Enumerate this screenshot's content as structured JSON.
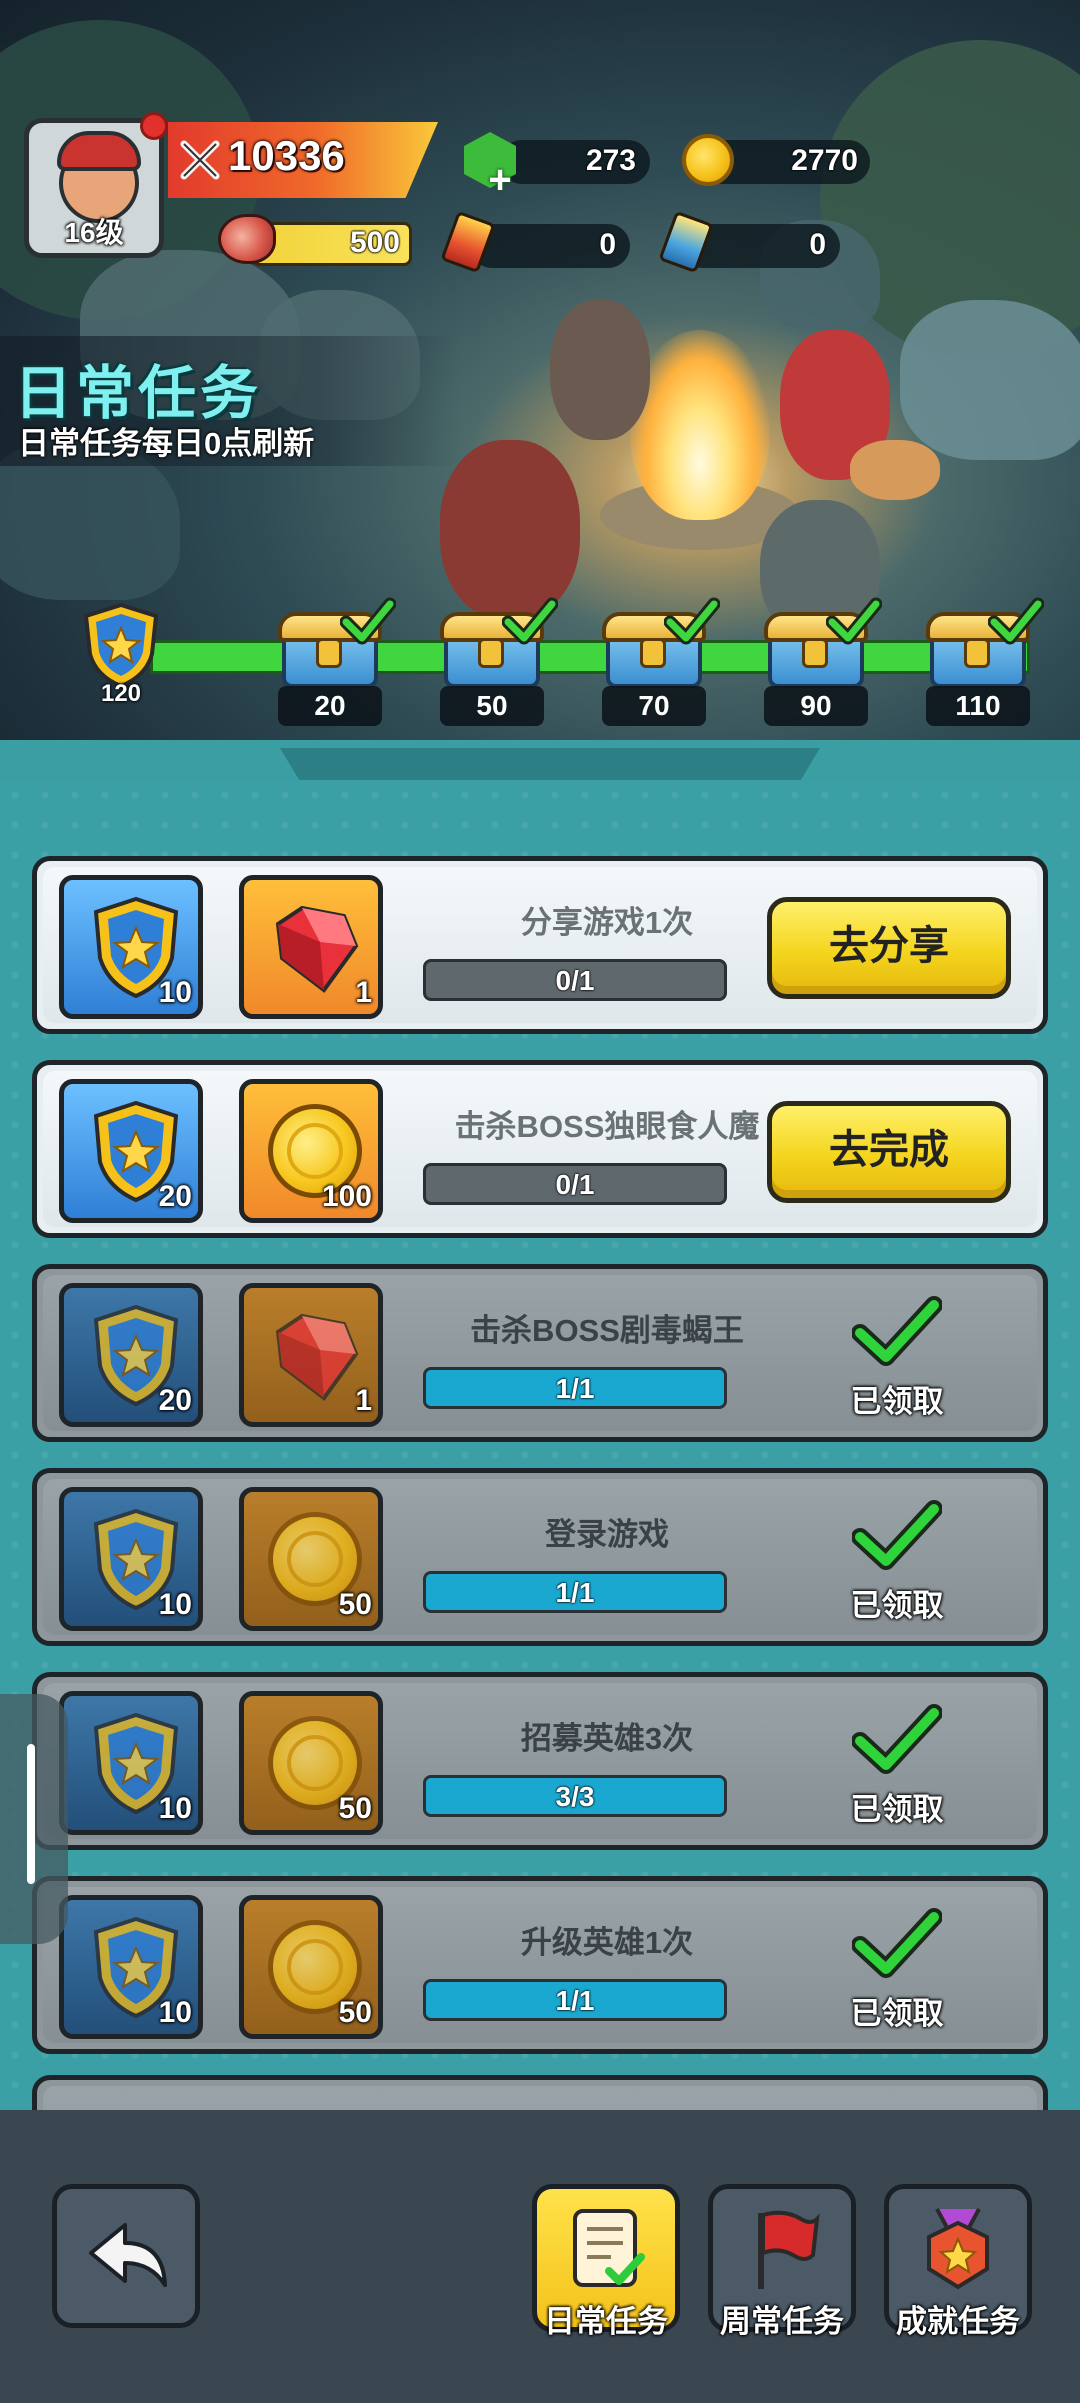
{
  "header": {
    "avatar_level": "16级",
    "power": "10336",
    "gems": "273",
    "coins": "2770",
    "stamina": "500",
    "red_tickets": "0",
    "blue_tickets": "0"
  },
  "page": {
    "title": "日常任务",
    "subtitle": "日常任务每日0点刷新"
  },
  "progress_track": {
    "current_points": "120",
    "milestones": [
      {
        "points": "20",
        "claimed": true
      },
      {
        "points": "50",
        "claimed": true
      },
      {
        "points": "70",
        "claimed": true
      },
      {
        "points": "90",
        "claimed": true
      },
      {
        "points": "110",
        "claimed": true
      }
    ]
  },
  "tasks": [
    {
      "name": "分享游戏1次",
      "points": "10",
      "reward_type": "gem",
      "reward_qty": "1",
      "progress": "0/1",
      "progress_fraction": 0,
      "status": "active",
      "button": "去分享"
    },
    {
      "name": "击杀BOSS独眼食人魔",
      "points": "20",
      "reward_type": "coin",
      "reward_qty": "100",
      "progress": "0/1",
      "progress_fraction": 0,
      "status": "active",
      "button": "去完成"
    },
    {
      "name": "击杀BOSS剧毒蝎王",
      "points": "20",
      "reward_type": "gem",
      "reward_qty": "1",
      "progress": "1/1",
      "progress_fraction": 1,
      "status": "claimed",
      "claimed_label": "已领取"
    },
    {
      "name": "登录游戏",
      "points": "10",
      "reward_type": "coin",
      "reward_qty": "50",
      "progress": "1/1",
      "progress_fraction": 1,
      "status": "claimed",
      "claimed_label": "已领取"
    },
    {
      "name": "招募英雄3次",
      "points": "10",
      "reward_type": "coin",
      "reward_qty": "50",
      "progress": "3/3",
      "progress_fraction": 1,
      "status": "claimed",
      "claimed_label": "已领取"
    },
    {
      "name": "升级英雄1次",
      "points": "10",
      "reward_type": "coin",
      "reward_qty": "50",
      "progress": "1/1",
      "progress_fraction": 1,
      "status": "claimed",
      "claimed_label": "已领取"
    }
  ],
  "bottom_nav": {
    "tabs": [
      {
        "label": "日常任务",
        "icon": "daily-scroll-icon",
        "selected": true
      },
      {
        "label": "周常任务",
        "icon": "red-flag-icon",
        "selected": false
      },
      {
        "label": "成就任务",
        "icon": "medal-icon",
        "selected": false
      }
    ]
  },
  "colors": {
    "accent_yellow": "#f4d51e",
    "track_green": "#3fd63f",
    "progress_blue": "#1aa7d0",
    "title_cyan": "#7ff0ef"
  }
}
